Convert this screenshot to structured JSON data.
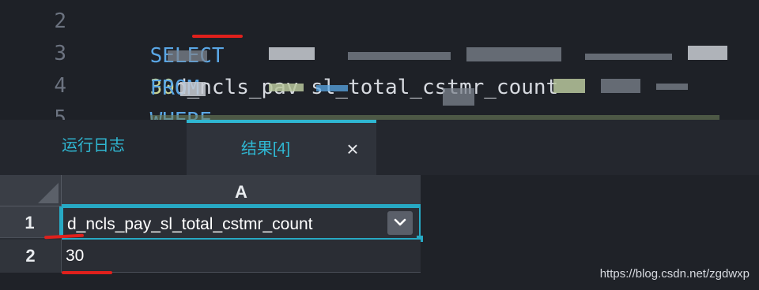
{
  "editor": {
    "line_numbers": [
      "2",
      "3",
      "4",
      "5"
    ],
    "lines": [
      {
        "keyword": "SELECT",
        "number": "30",
        "rest": "d_ncls_pav sl_total_cstmr_count"
      },
      {
        "keyword": "FROM",
        "rest": ""
      },
      {
        "keyword": "WHERE",
        "rest": ""
      }
    ]
  },
  "tabs": {
    "log_label": "运行日志",
    "result_label": "结果[4]",
    "close_symbol": "×"
  },
  "grid": {
    "column_header": "A",
    "row_numbers": [
      "1",
      "2"
    ],
    "cells": [
      "d_ncls_pay_sl_total_cstmr_count",
      "30"
    ]
  },
  "watermark": "https://blog.csdn.net/zgdwxp",
  "colors": {
    "accent": "#27a9c4",
    "keyword": "#5aa7e6",
    "annotation_red": "#e0201c"
  }
}
